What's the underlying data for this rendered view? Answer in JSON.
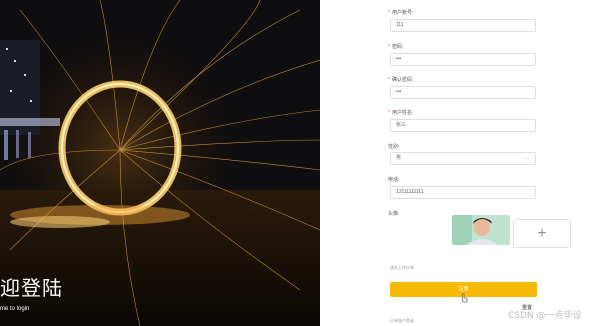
{
  "hero": {
    "title": "迎登陆",
    "subtitle": "me to login"
  },
  "form": {
    "account": {
      "label": "用户账号:",
      "required": "*",
      "value": "111"
    },
    "password": {
      "label": "密码:",
      "required": "*",
      "value": "•••"
    },
    "confirm_password": {
      "label": "确认密码:",
      "required": "*",
      "value": "•••"
    },
    "username": {
      "label": "用户姓名:",
      "required": "*",
      "value": "张三"
    },
    "gender": {
      "label": "性别:",
      "value": "男",
      "arrow": "⌄"
    },
    "phone": {
      "label": "电话:",
      "value": "13111111111"
    },
    "avatar": {
      "label": "头像:",
      "add_symbol": "+"
    },
    "hint": "请先上传头像",
    "submit_label": "注册",
    "reset_label": "重置",
    "login_link": "已有账户登录"
  },
  "watermark": "CSDN @一点毕设",
  "colors": {
    "accent": "#f8ba08",
    "required": "#e84a4a",
    "border": "#dcdfe6"
  }
}
